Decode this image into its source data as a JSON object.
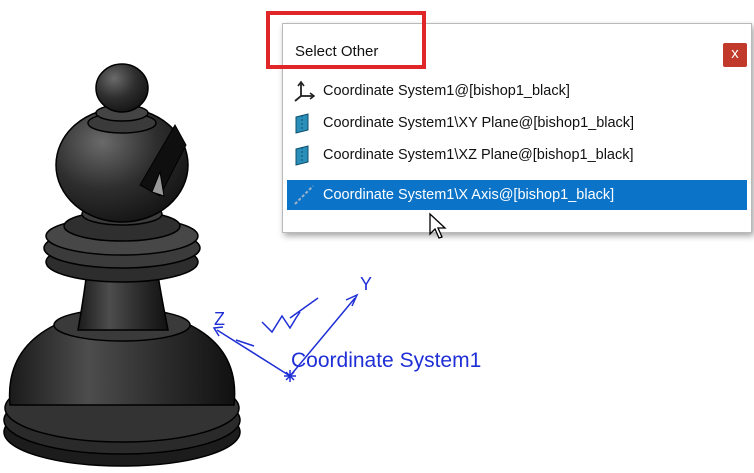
{
  "popup": {
    "title": "Select Other",
    "close_label": "x",
    "items": [
      {
        "label": "Coordinate System1@[bishop1_black]",
        "icon": "coordinate-system-icon",
        "selected": false
      },
      {
        "label": "Coordinate System1\\XY Plane@[bishop1_black]",
        "icon": "plane-icon",
        "selected": false
      },
      {
        "label": "Coordinate System1\\XZ Plane@[bishop1_black]",
        "icon": "plane-icon",
        "selected": false
      },
      {
        "label": "Coordinate System1\\X Axis@[bishop1_black]",
        "icon": "axis-icon",
        "selected": true
      }
    ]
  },
  "viewport": {
    "coordinate_label": "Coordinate System1",
    "axis_labels": {
      "y": "Y",
      "z": "Z"
    }
  },
  "colors": {
    "selection": "#0b74c9",
    "highlight_box": "#e1262a",
    "close_button": "#c0392b",
    "triad": "#1f2fd6"
  }
}
